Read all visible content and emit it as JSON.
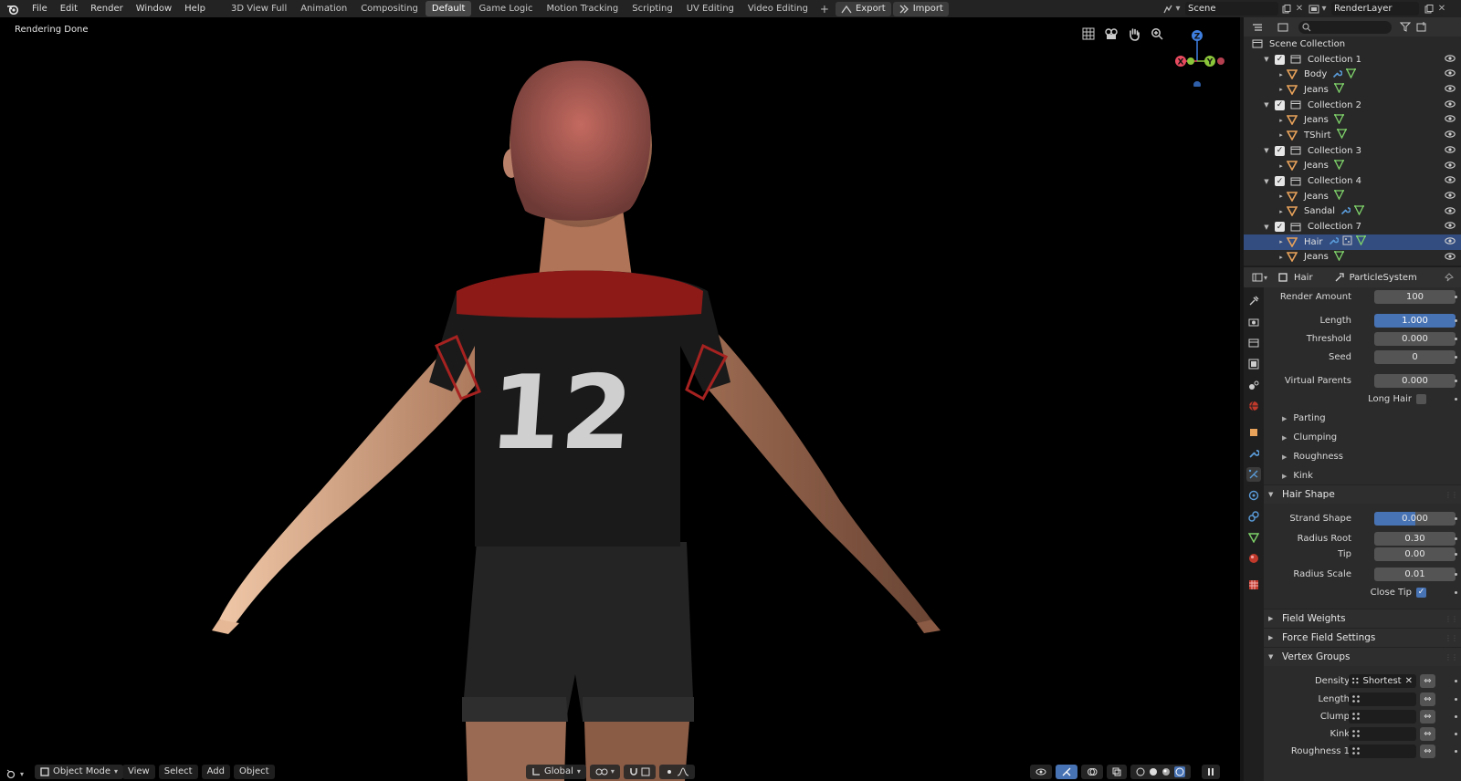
{
  "topbar": {
    "menus": [
      "File",
      "Edit",
      "Render",
      "Window",
      "Help"
    ],
    "workspaces": [
      "3D View Full",
      "Animation",
      "Compositing",
      "Default",
      "Game Logic",
      "Motion Tracking",
      "Scripting",
      "UV Editing",
      "Video Editing"
    ],
    "active_workspace": "Default",
    "add_tab": "+",
    "export_label": "Export",
    "import_label": "Import",
    "scene_name": "Scene",
    "render_layer": "RenderLayer"
  },
  "viewport": {
    "status": "Rendering Done",
    "jersey_number": "12",
    "axes": {
      "z": "Z",
      "x": "X",
      "y": "Y"
    },
    "header": {
      "mode": "Object Mode",
      "menus": [
        "View",
        "Select",
        "Add",
        "Object"
      ],
      "orientation": "Global"
    }
  },
  "outliner": {
    "root": "Scene Collection",
    "rows": [
      {
        "label": "Collection 1",
        "kind": "collection"
      },
      {
        "label": "Body",
        "kind": "object"
      },
      {
        "label": "Jeans",
        "kind": "object"
      },
      {
        "label": "Collection 2",
        "kind": "collection"
      },
      {
        "label": "Jeans",
        "kind": "object"
      },
      {
        "label": "TShirt",
        "kind": "object"
      },
      {
        "label": "Collection 3",
        "kind": "collection"
      },
      {
        "label": "Jeans",
        "kind": "object"
      },
      {
        "label": "Collection 4",
        "kind": "collection"
      },
      {
        "label": "Jeans",
        "kind": "object"
      },
      {
        "label": "Sandal",
        "kind": "object"
      },
      {
        "label": "Collection 7",
        "kind": "collection"
      },
      {
        "label": "Hair",
        "kind": "object",
        "selected": true
      },
      {
        "label": "Jeans",
        "kind": "object"
      }
    ]
  },
  "properties": {
    "object_name": "Hair",
    "particle_system": "ParticleSystem",
    "render_amount": {
      "label": "Render Amount",
      "value": "100"
    },
    "length": {
      "label": "Length",
      "value": "1.000"
    },
    "threshold": {
      "label": "Threshold",
      "value": "0.000"
    },
    "seed": {
      "label": "Seed",
      "value": "0"
    },
    "virtual_parents": {
      "label": "Virtual Parents",
      "value": "0.000"
    },
    "long_hair": {
      "label": "Long Hair",
      "checked": false
    },
    "subpanels": [
      "Parting",
      "Clumping",
      "Roughness",
      "Kink"
    ],
    "hair_shape": {
      "title": "Hair Shape",
      "strand_shape": {
        "label": "Strand Shape",
        "value": "0.000",
        "fill": 0.5
      },
      "radius_root": {
        "label": "Radius Root",
        "value": "0.30"
      },
      "tip": {
        "label": "Tip",
        "value": "0.00"
      },
      "radius_scale": {
        "label": "Radius Scale",
        "value": "0.01"
      },
      "close_tip": {
        "label": "Close Tip",
        "checked": true
      }
    },
    "field_weights": "Field Weights",
    "force_field_settings": "Force Field Settings",
    "vertex_groups": {
      "title": "Vertex Groups",
      "rows": [
        {
          "label": "Density",
          "value": "Shortest"
        },
        {
          "label": "Length",
          "value": ""
        },
        {
          "label": "Clump",
          "value": ""
        },
        {
          "label": "Kink",
          "value": ""
        },
        {
          "label": "Roughness 1",
          "value": ""
        }
      ]
    }
  },
  "colors": {
    "accent": "#4772b3",
    "selection": "#334d80",
    "background": "#1d1d1d",
    "object_orange": "#e8a25a",
    "mesh_green": "#7fd36a",
    "axis_x": "#e84a5f",
    "axis_y": "#8bc53a",
    "axis_z": "#3f7fe0"
  }
}
